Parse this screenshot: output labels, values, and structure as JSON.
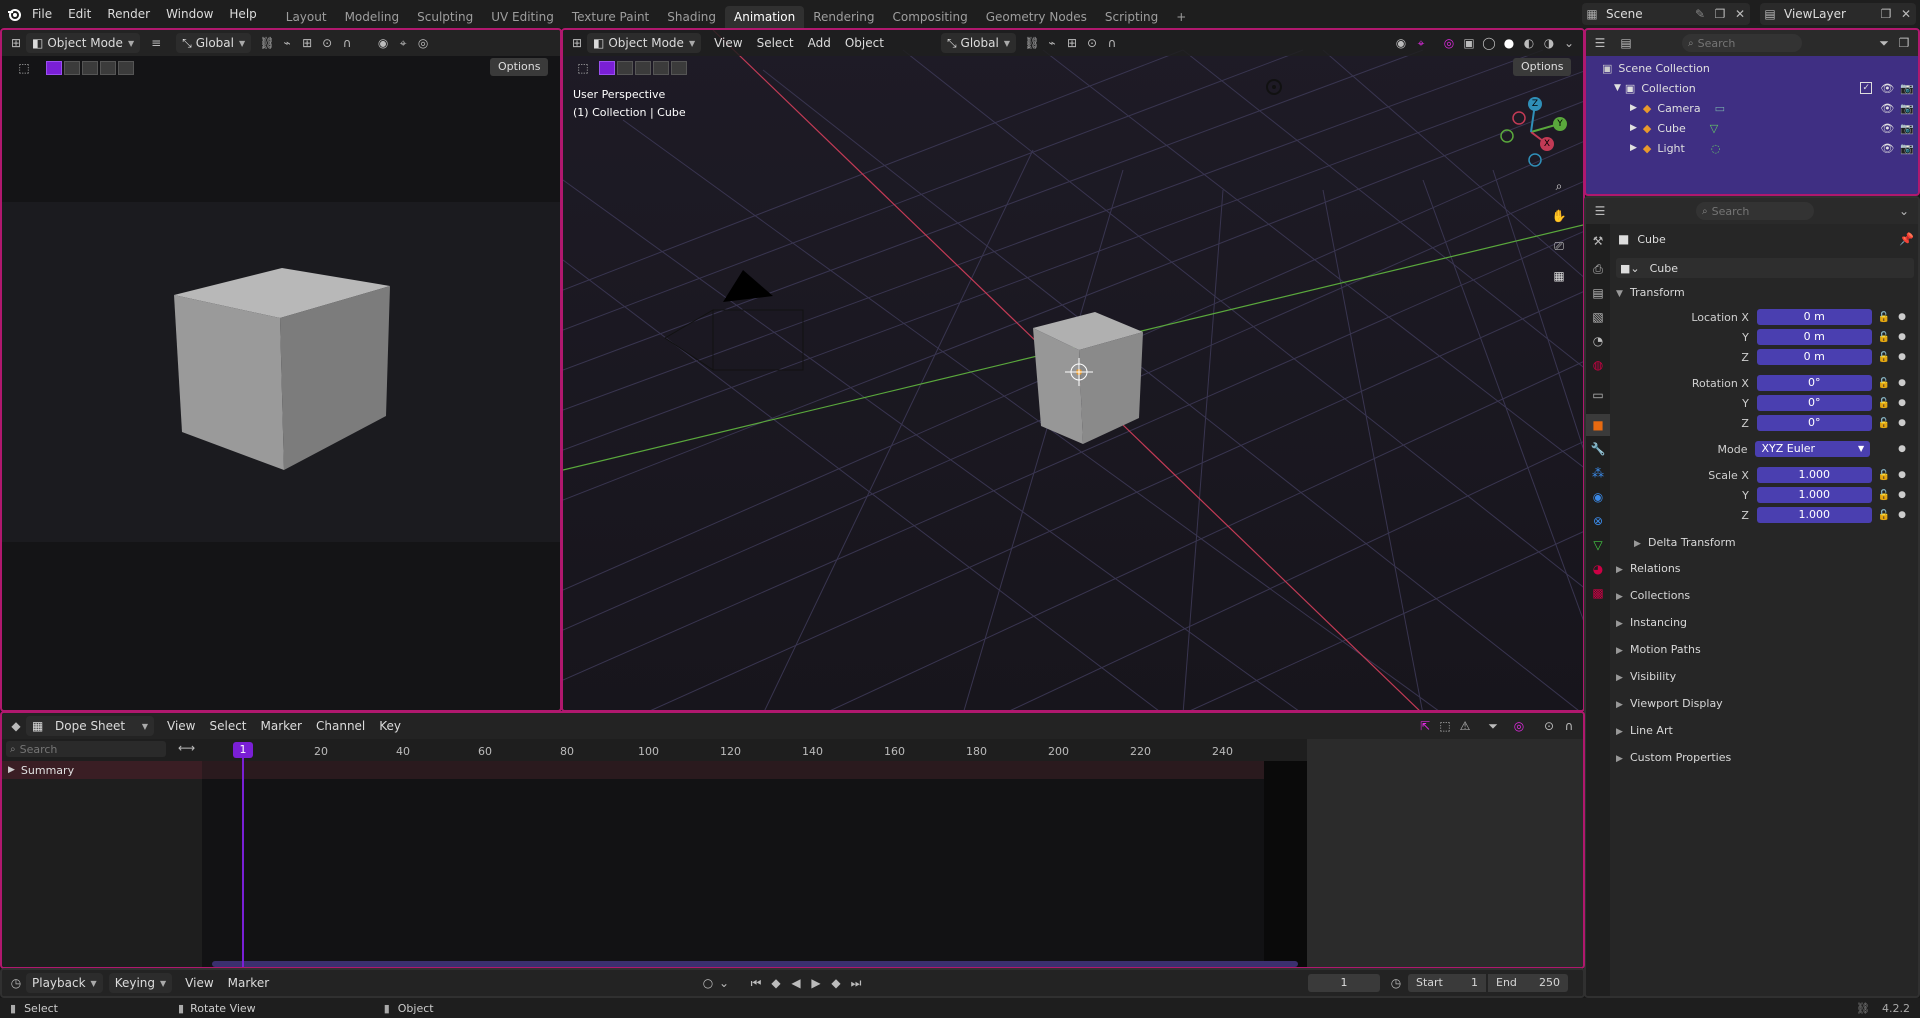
{
  "topbar": {
    "menus": [
      "File",
      "Edit",
      "Render",
      "Window",
      "Help"
    ],
    "workspaces": [
      "Layout",
      "Modeling",
      "Sculpting",
      "UV Editing",
      "Texture Paint",
      "Shading",
      "Animation",
      "Rendering",
      "Compositing",
      "Geometry Nodes",
      "Scripting"
    ],
    "active_workspace": "Animation",
    "add_tab": "+",
    "scene": "Scene",
    "view_layer": "ViewLayer"
  },
  "camera_view": {
    "mode": "Object Mode",
    "orientation": "Global",
    "options": "Options"
  },
  "viewport": {
    "mode": "Object Mode",
    "menus": [
      "View",
      "Select",
      "Add",
      "Object"
    ],
    "orientation": "Global",
    "options": "Options",
    "perspective": "User Perspective",
    "collection_info": "(1) Collection | Cube",
    "gizmo": {
      "x": "X",
      "y": "Y",
      "z": "Z"
    }
  },
  "outliner": {
    "search_placeholder": "Search",
    "root": "Scene Collection",
    "collection": "Collection",
    "items": [
      {
        "name": "Camera",
        "icon": "camera-icon"
      },
      {
        "name": "Cube",
        "icon": "mesh-icon"
      },
      {
        "name": "Light",
        "icon": "light-icon"
      }
    ]
  },
  "properties": {
    "search_placeholder": "Search",
    "object_name": "Cube",
    "datablock_name": "Cube",
    "transform_title": "Transform",
    "location": {
      "label": "Location X",
      "x": "0 m",
      "y": "0 m",
      "z": "0 m"
    },
    "rotation": {
      "label": "Rotation X",
      "x": "0°",
      "y": "0°",
      "z": "0°"
    },
    "mode": {
      "label": "Mode",
      "value": "XYZ Euler"
    },
    "scale": {
      "label": "Scale X",
      "x": "1.000",
      "y": "1.000",
      "z": "1.000"
    },
    "axis_y": "Y",
    "axis_z": "Z",
    "delta_transform": "Delta Transform",
    "sections": [
      "Relations",
      "Collections",
      "Instancing",
      "Motion Paths",
      "Visibility",
      "Viewport Display",
      "Line Art",
      "Custom Properties"
    ]
  },
  "dopesheet": {
    "editor": "Dope Sheet",
    "menus": [
      "View",
      "Select",
      "Marker",
      "Channel",
      "Key"
    ],
    "search_placeholder": "Search",
    "summary": "Summary",
    "current_frame_badge": "1",
    "ticks": [
      "20",
      "40",
      "60",
      "80",
      "100",
      "120",
      "140",
      "160",
      "180",
      "200",
      "220",
      "240"
    ]
  },
  "timeline": {
    "menus": [
      "Playback",
      "Keying",
      "View",
      "Marker"
    ],
    "current_frame": "1",
    "start_label": "Start",
    "start": "1",
    "end_label": "End",
    "end": "250"
  },
  "status": {
    "select": "Select",
    "rotate": "Rotate View",
    "object": "Object",
    "version": "4.2.2"
  },
  "colors": {
    "accent": "#7a1fd6",
    "border": "#b0186e",
    "field": "#4a3fb0"
  }
}
